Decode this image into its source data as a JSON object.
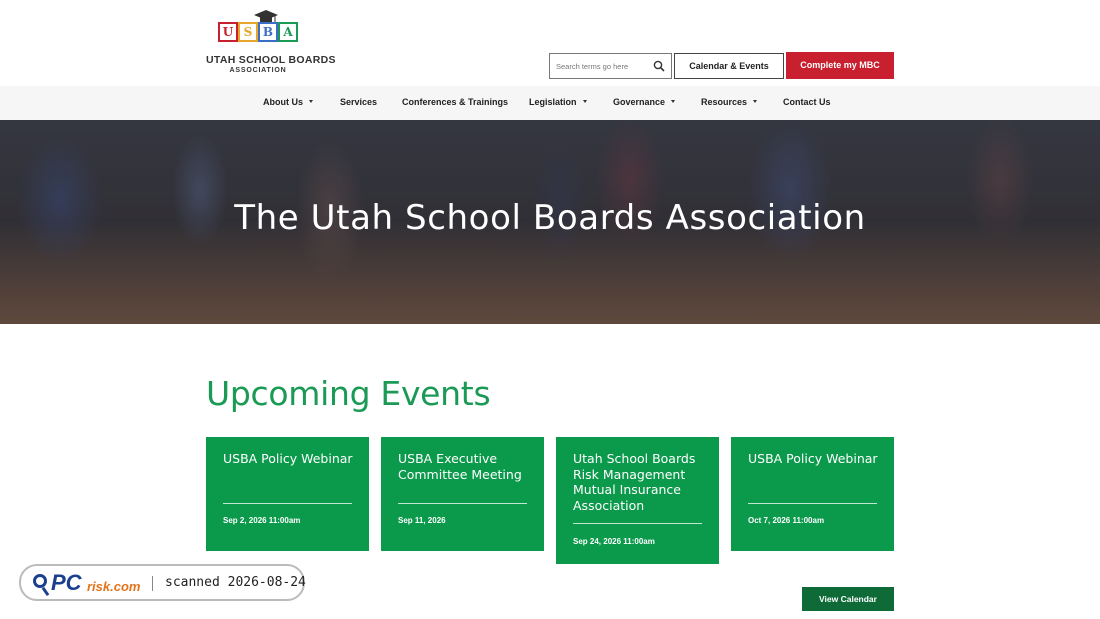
{
  "brand": {
    "blocks": [
      "U",
      "S",
      "B",
      "A"
    ],
    "title": "UTAH SCHOOL BOARDS",
    "subtitle": "ASSOCIATION",
    "block_colors": [
      "#c8202e",
      "#e8a72b",
      "#3b6fc6",
      "#1a9a55"
    ]
  },
  "search": {
    "placeholder": "Search terms go here",
    "icon": "magnifier-icon"
  },
  "header_buttons": {
    "calendar": "Calendar & Events",
    "mbc": "Complete my MBC"
  },
  "nav": {
    "items": [
      {
        "label": "About Us",
        "dropdown": true
      },
      {
        "label": "Services",
        "dropdown": false
      },
      {
        "label": "Conferences & Trainings",
        "dropdown": false
      },
      {
        "label": "Legislation",
        "dropdown": true
      },
      {
        "label": "Governance",
        "dropdown": true
      },
      {
        "label": "Resources",
        "dropdown": true
      },
      {
        "label": "Contact Us",
        "dropdown": false
      }
    ]
  },
  "hero": {
    "title": "The Utah School Boards Association"
  },
  "events": {
    "heading": "Upcoming Events",
    "cards": [
      {
        "title": "USBA Policy Webinar",
        "date": "Sep 2, 2026 11:00am"
      },
      {
        "title": "USBA Executive Committee Meeting",
        "date": "Sep 11, 2026"
      },
      {
        "title": "Utah School Boards Risk Management Mutual Insurance Association",
        "date": "Sep 24, 2026 11:00am"
      },
      {
        "title": "USBA Policy Webinar",
        "date": "Oct 7, 2026 11:00am"
      }
    ],
    "view_calendar": "View Calendar"
  },
  "watermark": {
    "pc": "PC",
    "risk": "risk.com",
    "scan_text": "scanned 2026-08-24"
  },
  "colors": {
    "accent_green": "#0b9a4b",
    "dark_green": "#0e6b38",
    "brand_red": "#c8202e"
  }
}
